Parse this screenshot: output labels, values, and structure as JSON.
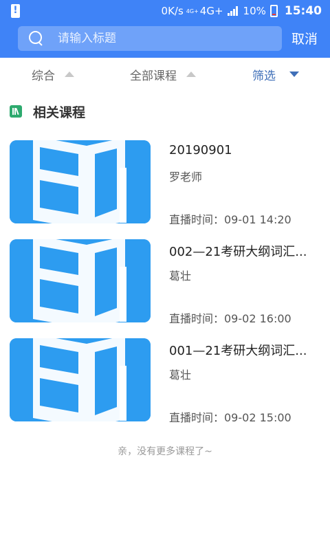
{
  "status_bar": {
    "speed": "0K/s",
    "network": "4G+",
    "network_sup": "4G+",
    "battery": "10%",
    "time": "15:40"
  },
  "search": {
    "placeholder": "请输入标题",
    "value": "",
    "cancel_label": "取消"
  },
  "filters": [
    {
      "label": "综合"
    },
    {
      "label": "全部课程"
    },
    {
      "label": "筛选"
    }
  ],
  "section": {
    "title": "相关课程"
  },
  "courses": [
    {
      "title": "20190901",
      "teacher": "罗老师",
      "time": "直播时间：09-01 14:20"
    },
    {
      "title": "002—21考研大纲词汇...",
      "teacher": "葛壮",
      "time": "直播时间：09-02 16:00"
    },
    {
      "title": "001—21考研大纲词汇...",
      "teacher": "葛壮",
      "time": "直播时间：09-02 15:00"
    }
  ],
  "footer": {
    "end_text": "亲，没有更多课程了~"
  },
  "colors": {
    "primary": "#3f83f7",
    "accent_green": "#2daa6e",
    "thumb_blue": "#2d9cf0"
  }
}
